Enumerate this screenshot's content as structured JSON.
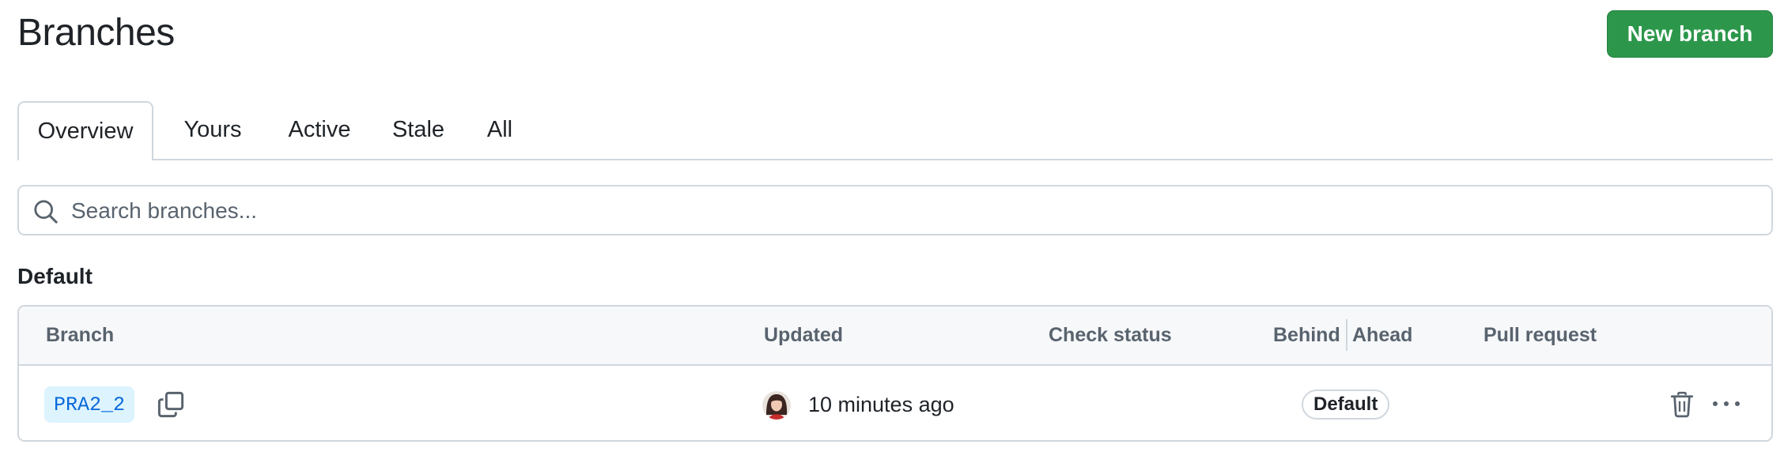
{
  "header": {
    "title": "Branches",
    "new_branch_label": "New branch"
  },
  "tabs": [
    {
      "label": "Overview",
      "selected": true
    },
    {
      "label": "Yours",
      "selected": false
    },
    {
      "label": "Active",
      "selected": false
    },
    {
      "label": "Stale",
      "selected": false
    },
    {
      "label": "All",
      "selected": false
    }
  ],
  "search": {
    "placeholder": "Search branches...",
    "value": "",
    "icon": "search-icon"
  },
  "sections": [
    {
      "heading": "Default",
      "columns": [
        "Branch",
        "Updated",
        "Check status",
        "Behind",
        "Ahead",
        "Pull request"
      ],
      "rows": [
        {
          "branch": "PRA2_2",
          "updated": "10 minutes ago",
          "check_status": "",
          "behind_ahead_badge": "Default",
          "pull_request": "",
          "icons": [
            "copy-icon",
            "avatar",
            "trash-icon",
            "kebab-horizontal-icon"
          ]
        }
      ]
    }
  ],
  "colors": {
    "primary_button": "#2c974b",
    "link": "#0969da",
    "branch_chip_bg": "#ddf4ff",
    "border": "#d0d7de",
    "header_bg": "#f6f8fa"
  }
}
